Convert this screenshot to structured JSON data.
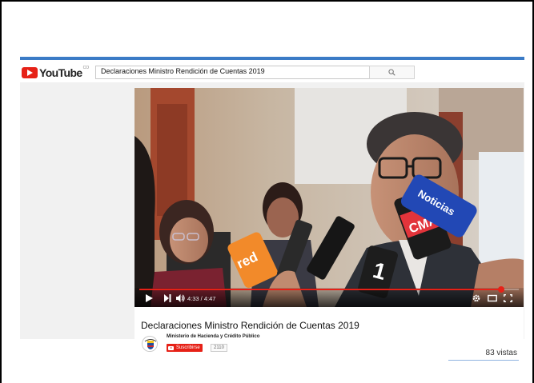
{
  "header": {
    "logo_text": "YouTube",
    "logo_suffix": "CO",
    "search_value": "Declaraciones Ministro Rendición de Cuentas 2019"
  },
  "player": {
    "time": "4:33 / 4:47",
    "progress": 0.954,
    "overlay_texts": [
      "red",
      "CMA",
      "1",
      "Noticias"
    ]
  },
  "video": {
    "title": "Declaraciones Ministro Rendición de Cuentas 2019",
    "channel": "Ministerio de Hacienda y Crédito Público",
    "subscribe_label": "Suscribirse",
    "subscriber_count": "2110",
    "views": "83 vistas"
  },
  "colors": {
    "brand_red": "#e62117",
    "accent_blue": "#3b7bc6"
  },
  "icons": {
    "play": "play-icon",
    "next": "next-icon",
    "volume": "volume-icon",
    "settings": "gear-icon",
    "theater": "theater-mode-icon",
    "fullscreen": "fullscreen-icon",
    "search": "search-icon"
  }
}
